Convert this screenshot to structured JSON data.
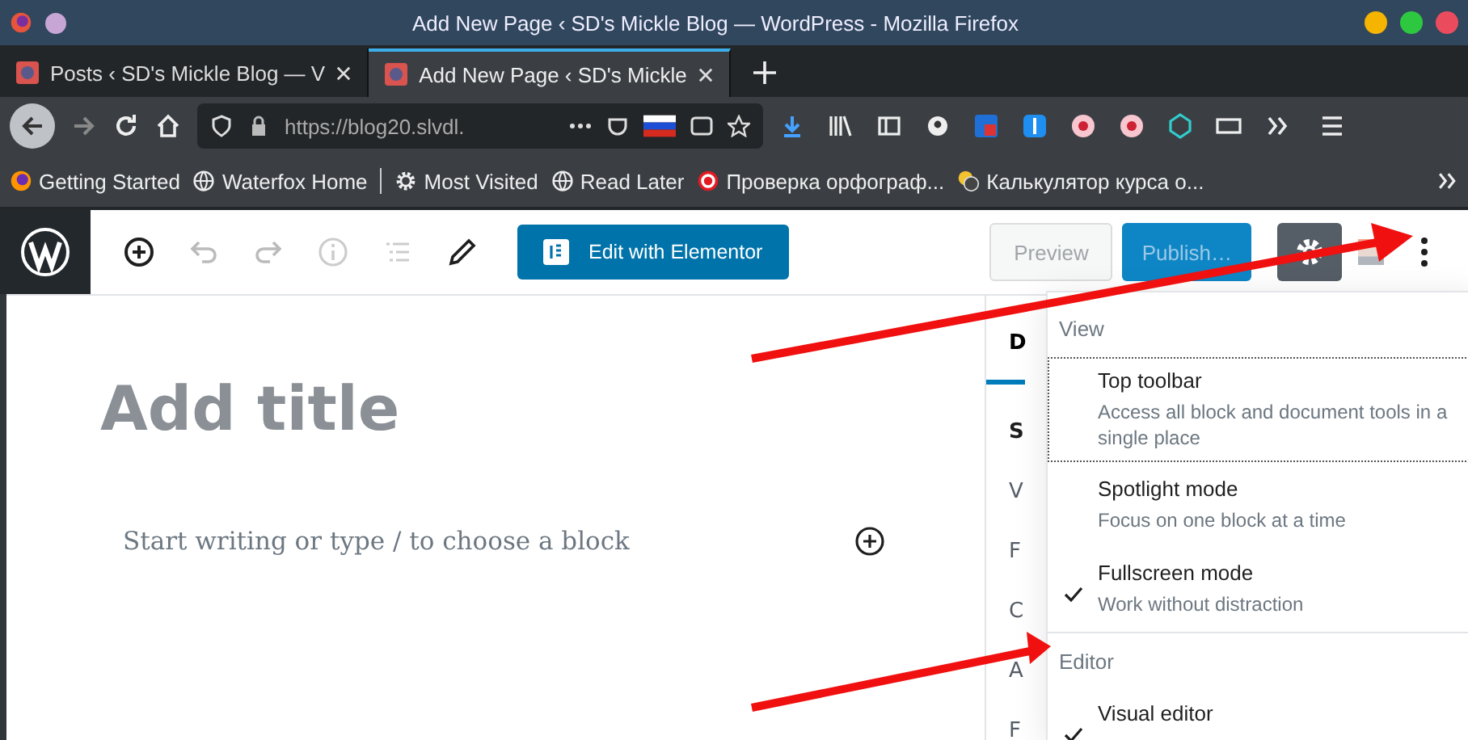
{
  "window": {
    "title": "Add New Page ‹ SD's Mickle Blog — WordPress - Mozilla Firefox"
  },
  "tabs": [
    {
      "label": "Posts ‹ SD's Mickle Blog — V",
      "selected": false
    },
    {
      "label": "Add New Page ‹ SD's Mickle",
      "selected": true
    }
  ],
  "url_bar": {
    "url": "https://blog20.slvdl."
  },
  "bookmarks": [
    {
      "kind": "firefox",
      "label": "Getting Started"
    },
    {
      "kind": "globe",
      "label": "Waterfox Home"
    },
    {
      "kind": "separator"
    },
    {
      "kind": "gear",
      "label": "Most Visited"
    },
    {
      "kind": "globe",
      "label": "Read Later"
    },
    {
      "kind": "copyright",
      "label": "Проверка орфограф..."
    },
    {
      "kind": "coins",
      "label": "Калькулятор курса о..."
    }
  ],
  "editor_toolbar": {
    "elementor_button": "Edit with Elementor",
    "preview_button": "Preview",
    "publish_button": "Publish…"
  },
  "editor": {
    "title_placeholder": "Add title",
    "block_placeholder": "Start writing or type / to choose a block"
  },
  "sidebar": {
    "tab": "D",
    "items": [
      "S",
      "V",
      "F",
      "C",
      "A",
      "F"
    ]
  },
  "more_menu": {
    "sections": [
      {
        "heading": "View",
        "items": [
          {
            "label": "Top toolbar",
            "description": "Access all block and document tools in a single place",
            "checked": false,
            "focused": true
          },
          {
            "label": "Spotlight mode",
            "description": "Focus on one block at a time",
            "checked": false,
            "focused": false
          },
          {
            "label": "Fullscreen mode",
            "description": "Work without distraction",
            "checked": true,
            "focused": false
          }
        ]
      },
      {
        "heading": "Editor",
        "items": [
          {
            "label": "Visual editor",
            "checked": true,
            "focused": false
          }
        ]
      }
    ]
  }
}
